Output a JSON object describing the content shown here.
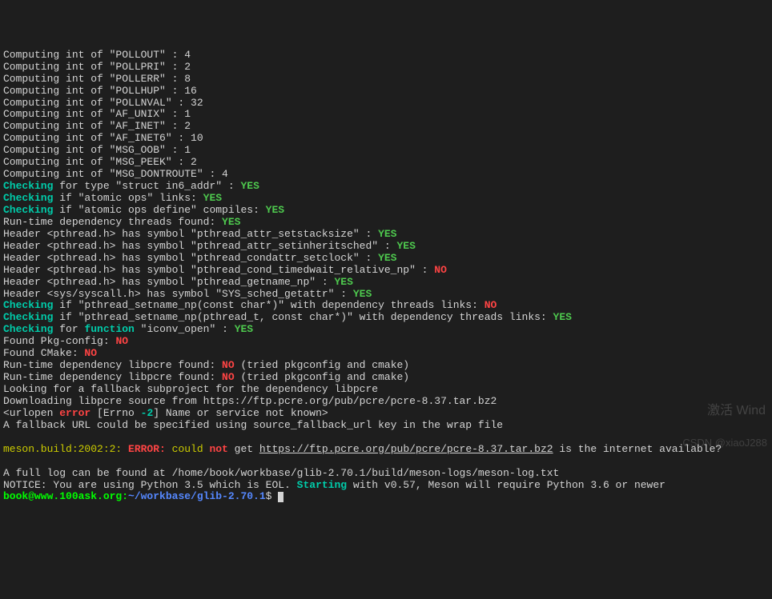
{
  "computing_lines": [
    {
      "name": "POLLOUT",
      "val": "4"
    },
    {
      "name": "POLLPRI",
      "val": "2"
    },
    {
      "name": "POLLERR",
      "val": "8"
    },
    {
      "name": "POLLHUP",
      "val": "16"
    },
    {
      "name": "POLLNVAL",
      "val": "32"
    },
    {
      "name": "AF_UNIX",
      "val": "1"
    },
    {
      "name": "AF_INET",
      "val": "2"
    },
    {
      "name": "AF_INET6",
      "val": "10"
    },
    {
      "name": "MSG_OOB",
      "val": "1"
    },
    {
      "name": "MSG_PEEK",
      "val": "2"
    },
    {
      "name": "MSG_DONTROUTE",
      "val": "4"
    }
  ],
  "check_struct_in6": {
    "label": "Checking",
    "text": " for type \"struct in6_addr\" : ",
    "result": "YES"
  },
  "check_atomic_ops": {
    "label": "Checking",
    "text": " if \"atomic ops\" links: ",
    "result": "YES"
  },
  "check_atomic_define": {
    "label": "Checking",
    "text": " if \"atomic ops define\" compiles: ",
    "result": "YES"
  },
  "runtime_threads": {
    "text": "Run-time dependency threads found: ",
    "result": "YES"
  },
  "headers": [
    {
      "text": "Header <pthread.h> has symbol \"pthread_attr_setstacksize\" : ",
      "result": "YES"
    },
    {
      "text": "Header <pthread.h> has symbol \"pthread_attr_setinheritsched\" : ",
      "result": "YES"
    },
    {
      "text": "Header <pthread.h> has symbol \"pthread_condattr_setclock\" : ",
      "result": "YES"
    },
    {
      "text": "Header <pthread.h> has symbol \"pthread_cond_timedwait_relative_np\" : ",
      "result": "NO",
      "neg": true
    },
    {
      "text": "Header <pthread.h> has symbol \"pthread_getname_np\" : ",
      "result": "YES"
    },
    {
      "text": "Header <sys/syscall.h> has symbol \"SYS_sched_getattr\" : ",
      "result": "YES"
    }
  ],
  "check_setname_const": {
    "label": "Checking",
    "text": " if \"pthread_setname_np(const char*)\" with dependency threads links: ",
    "result": "NO"
  },
  "check_setname_pthread": {
    "label": "Checking",
    "text": " if \"pthread_setname_np(pthread_t, const char*)\" with dependency threads links: ",
    "result": "YES"
  },
  "check_iconv": {
    "label": "Checking",
    "text1": " for ",
    "fn": "function",
    "text2": " \"iconv_open\" : ",
    "result": "YES"
  },
  "pkgconfig": {
    "text": "Found Pkg-config: ",
    "result": "NO"
  },
  "cmake": {
    "text": "Found CMake: ",
    "result": "NO"
  },
  "libpcre1": {
    "text": "Run-time dependency libpcre found: ",
    "result": "NO",
    "suffix": " (tried pkgconfig and cmake)"
  },
  "libpcre2": {
    "text": "Run-time dependency libpcre found: ",
    "result": "NO",
    "suffix": " (tried pkgconfig and cmake)"
  },
  "fallback_look": "Looking for a fallback subproject for the dependency libpcre",
  "downloading": "Downloading libpcre source from https://ftp.pcre.org/pub/pcre/pcre-8.37.tar.bz2",
  "urlopen": {
    "prefix": "<urlopen ",
    "err": "error",
    "errno_pre": " [Errno ",
    "errno": "-2",
    "suffix": "] Name or service not known>"
  },
  "fallback_url": "A fallback URL could be specified using source_fallback_url key in the wrap file",
  "meson_build": {
    "loc": "meson.build:2002:2: ",
    "err": "ERROR:",
    "could": " could",
    "not": " not",
    "get": " get ",
    "url": "https://ftp.pcre.org/pub/pcre/pcre-8.37.tar.bz2",
    "tail": " is the internet available?"
  },
  "full_log": "A full log can be found at /home/book/workbase/glib-2.70.1/build/meson-logs/meson-log.txt",
  "notice": {
    "prefix": "NOTICE: You are using Python 3.5 which is EOL. ",
    "starting": "Starting",
    "suffix": " with v0.57, Meson will require Python 3.6 or newer"
  },
  "prompt": {
    "user_host": "book@www.100ask.org:",
    "path": "~/workbase/glib-2.70.1",
    "dollar": "$ "
  },
  "watermark_activate": "激活 Wind",
  "watermark_csdn": "CSDN @xiaoJ288"
}
